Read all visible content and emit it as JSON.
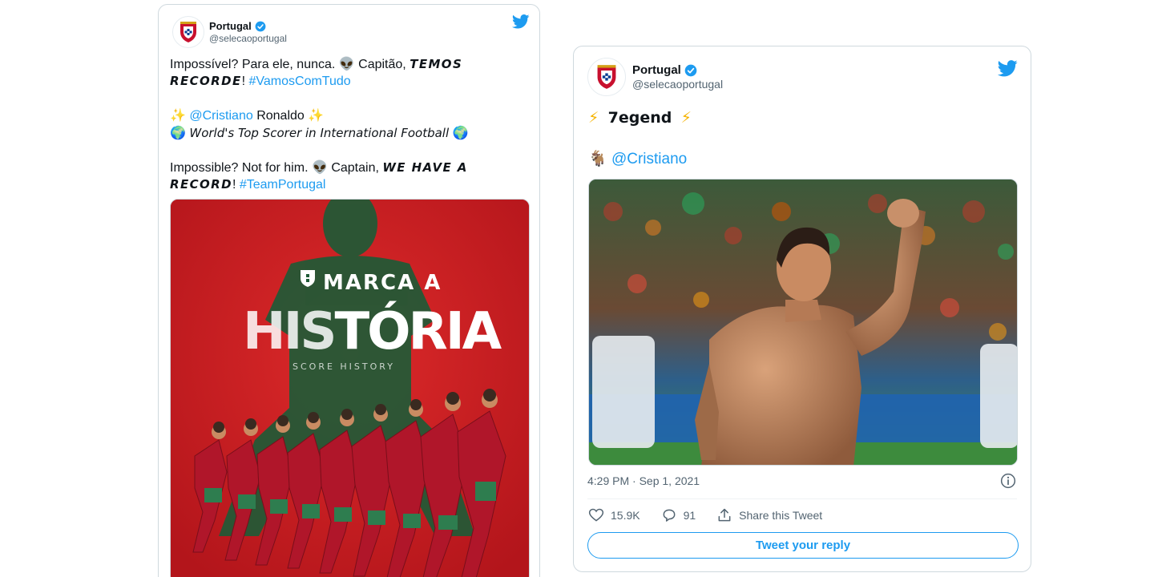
{
  "tweets": [
    {
      "name": "Portugal",
      "handle": "@selecaoportugal",
      "lines": {
        "l1_text": "Impossível? Para ele, nunca. ",
        "l1_emoji": "👽",
        "l1_text2": " Capitão, ",
        "l1_bold": "TEMOS",
        "l2_bold": "RECORDE",
        "l2_text": "! ",
        "l2_link": "#VamosComTudo",
        "l3_emoji_a": "✨",
        "l3_link": "@Cristiano",
        "l3_text": " Ronaldo ",
        "l3_emoji_b": "✨",
        "l4_emoji_a": "🌍",
        "l4_italic": "World's Top Scorer in International Football",
        "l4_emoji_b": "🌍",
        "l5_text": "Impossible? Not for him. ",
        "l5_emoji": "👽",
        "l5_text2": " Captain, ",
        "l5_bold": "WE HAVE A",
        "l6_bold": "RECORD",
        "l6_text": "! ",
        "l6_link": "#TeamPortugal"
      },
      "media": {
        "title_top": "MARCA A",
        "title_main_a": "HIS",
        "title_main_b": "TÓRIA",
        "subtitle": "SCORE HISTORY"
      }
    },
    {
      "name": "Portugal",
      "handle": "@selecaoportugal",
      "line1_emoji": "⚡",
      "line1_text": "7egend",
      "line2_emoji": "🐐",
      "line2_link": "@Cristiano",
      "timestamp": "4:29 PM · Sep 1, 2021",
      "likes": "15.9K",
      "replies": "91",
      "share_label": "Share this Tweet",
      "reply_button": "Tweet your reply"
    }
  ],
  "colors": {
    "accent": "#1d9bf0",
    "poster_red": "#cf1f24",
    "jersey_green": "#1f6b3a"
  },
  "icons": [
    "portugal-crest-icon",
    "verified-badge-icon",
    "twitter-bird-icon",
    "heart-icon",
    "reply-icon",
    "share-icon",
    "info-icon"
  ]
}
